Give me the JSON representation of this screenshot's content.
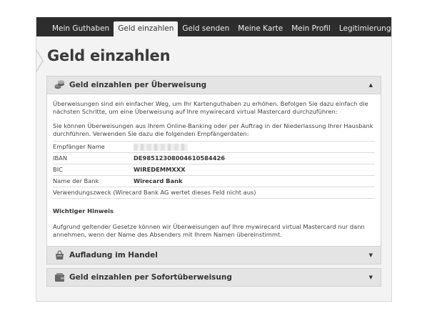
{
  "nav": {
    "items": [
      {
        "label": "Mein Guthaben"
      },
      {
        "label": "Geld einzahlen",
        "active": true
      },
      {
        "label": "Geld senden"
      },
      {
        "label": "Meine Karte"
      },
      {
        "label": "Mein Profil"
      },
      {
        "label": "Legitimierung"
      }
    ]
  },
  "page": {
    "title": "Geld einzahlen"
  },
  "sections": {
    "transfer": {
      "title": "Geld einzahlen per Überweisung",
      "arrow": "▲",
      "icon": "coins-icon",
      "intro": "Überweisungen sind ein einfacher Weg, um Ihr Kartenguthaben zu erhöhen. Befolgen Sie dazu einfach die nächsten Schritte, um eine Überweisung auf Ihre mywirecard virtual Mastercard durchzuführen:",
      "instructions": "Sie können Überweisungen aus Ihrem Online-Banking oder per Auftrag in der Niederlassung Ihrer Hausbank durchführen. Verwenden Sie dazu die folgenden Empfängerdaten:",
      "table": {
        "recipient_label": "Empfänger Name",
        "iban_label": "IBAN",
        "iban_value": "DE98512308004610584426",
        "bic_label": "BIC",
        "bic_value": "WIREDEMMXXX",
        "bank_label": "Name der Bank",
        "bank_value": "Wirecard Bank",
        "purpose_label": "Verwendungszweck (Wirecard Bank AG wertet dieses Feld nicht aus)"
      },
      "hint_title": "Wichtiger Hinweis",
      "hint_text": "Aufgrund geltender Gesetze können wir Überweisungen auf Ihre mywirecard virtual Mastercard nur dann annehmen, wenn der Name des Absenders mit Ihrem Namen übereinstimmt."
    },
    "retail": {
      "title": "Aufladung im Handel",
      "arrow": "▼",
      "icon": "shopping-bag-icon"
    },
    "instant": {
      "title": "Geld einzahlen per Sofortüberweisung",
      "arrow": "▼",
      "icon": "wallet-icon"
    }
  },
  "colors": {
    "navbar": "#2d2d2d",
    "frame": "#f3f3f3",
    "header": "#e4e4e4"
  }
}
